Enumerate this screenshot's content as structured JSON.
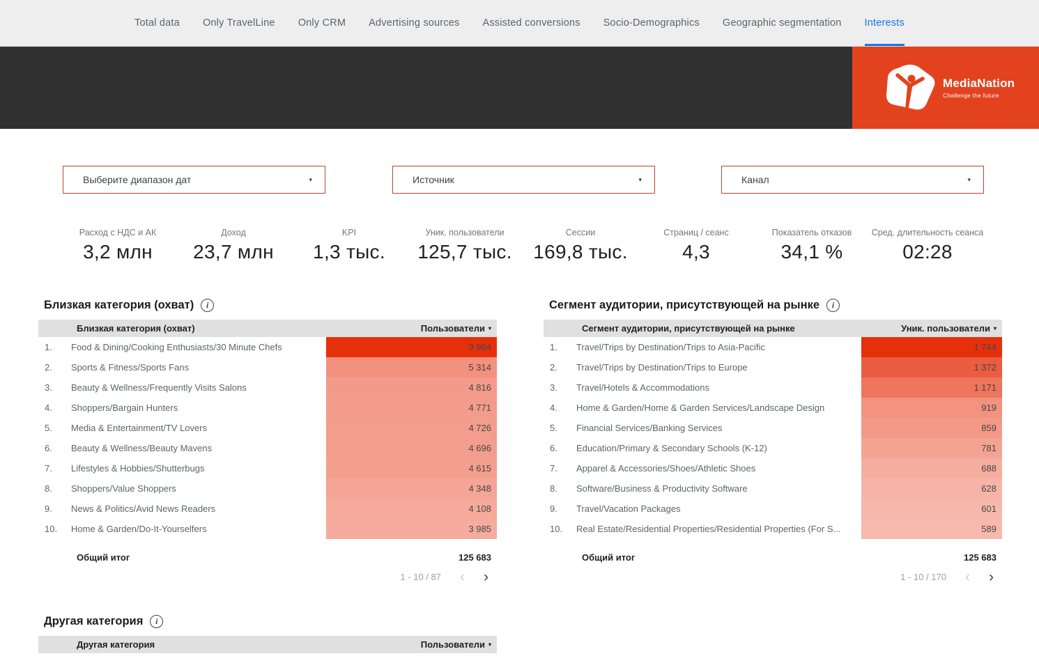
{
  "tabs": [
    {
      "label": "Total data",
      "active": false
    },
    {
      "label": "Only TravelLine",
      "active": false
    },
    {
      "label": "Only CRM",
      "active": false
    },
    {
      "label": "Advertising sources",
      "active": false
    },
    {
      "label": "Assisted conversions",
      "active": false
    },
    {
      "label": "Socio-Demographics",
      "active": false
    },
    {
      "label": "Geographic segmentation",
      "active": false
    },
    {
      "label": "Interests",
      "active": true
    }
  ],
  "brand": {
    "name": "MediaNation",
    "tagline": "Challenge the future"
  },
  "colors": {
    "accent_red": "#e2431e",
    "header_dark": "#313131",
    "heat_base": "#e6300c",
    "active_tab_blue": "#1a73e8",
    "filter_border": "#b04a2c"
  },
  "icons": {
    "sort_caret": "▾",
    "dropdown_caret": "▾",
    "info": "i",
    "page_prev": "‹",
    "page_next": "›"
  },
  "filters": [
    {
      "label": "Выберите диапазон дат"
    },
    {
      "label": "Источник"
    },
    {
      "label": "Канал"
    }
  ],
  "kpis": [
    {
      "label": "Расход с НДС и АК",
      "value": "3,2 млн"
    },
    {
      "label": "Доход",
      "value": "23,7 млн"
    },
    {
      "label": "KPI",
      "value": "1,3 тыс."
    },
    {
      "label": "Уник. пользователи",
      "value": "125,7 тыс."
    },
    {
      "label": "Сессии",
      "value": "169,8 тыс."
    },
    {
      "label": "Страниц / сеанс",
      "value": "4,3"
    },
    {
      "label": "Показатель отказов",
      "value": "34,1 %"
    },
    {
      "label": "Сред. длительность сеанса",
      "value": "02:28"
    }
  ],
  "tables": [
    {
      "title": "Близкая категория (охват)",
      "col_dimension": "Близкая категория (охват)",
      "col_metric": "Пользователи",
      "max": 9964,
      "rows": [
        {
          "n": "1.",
          "label": "Food & Dining/Cooking Enthusiasts/30 Minute Chefs",
          "display": "9 964",
          "value": 9964
        },
        {
          "n": "2.",
          "label": "Sports & Fitness/Sports Fans",
          "display": "5 314",
          "value": 5314
        },
        {
          "n": "3.",
          "label": "Beauty & Wellness/Frequently Visits Salons",
          "display": "4 816",
          "value": 4816
        },
        {
          "n": "4.",
          "label": "Shoppers/Bargain Hunters",
          "display": "4 771",
          "value": 4771
        },
        {
          "n": "5.",
          "label": "Media & Entertainment/TV Lovers",
          "display": "4 726",
          "value": 4726
        },
        {
          "n": "6.",
          "label": "Beauty & Wellness/Beauty Mavens",
          "display": "4 696",
          "value": 4696
        },
        {
          "n": "7.",
          "label": "Lifestyles & Hobbies/Shutterbugs",
          "display": "4 615",
          "value": 4615
        },
        {
          "n": "8.",
          "label": "Shoppers/Value Shoppers",
          "display": "4 348",
          "value": 4348
        },
        {
          "n": "9.",
          "label": "News & Politics/Avid News Readers",
          "display": "4 108",
          "value": 4108
        },
        {
          "n": "10.",
          "label": "Home & Garden/Do-It-Yourselfers",
          "display": "3 985",
          "value": 3985
        }
      ],
      "total_label": "Общий итог",
      "total_value": "125 683",
      "pagination": "1 - 10 / 87"
    },
    {
      "title": "Сегмент аудитории, присутствующей на рынке",
      "col_dimension": "Сегмент аудитории, присутствующей на рынке",
      "col_metric": "Уник. пользователи",
      "max": 1744,
      "rows": [
        {
          "n": "1.",
          "label": "Travel/Trips by Destination/Trips to Asia-Pacific",
          "display": "1 744",
          "value": 1744
        },
        {
          "n": "2.",
          "label": "Travel/Trips by Destination/Trips to Europe",
          "display": "1 372",
          "value": 1372
        },
        {
          "n": "3.",
          "label": "Travel/Hotels & Accommodations",
          "display": "1 171",
          "value": 1171
        },
        {
          "n": "4.",
          "label": "Home & Garden/Home & Garden Services/Landscape Design",
          "display": "919",
          "value": 919
        },
        {
          "n": "5.",
          "label": "Financial Services/Banking Services",
          "display": "859",
          "value": 859
        },
        {
          "n": "6.",
          "label": "Education/Primary & Secondary Schools (K-12)",
          "display": "781",
          "value": 781
        },
        {
          "n": "7.",
          "label": "Apparel & Accessories/Shoes/Athletic Shoes",
          "display": "688",
          "value": 688
        },
        {
          "n": "8.",
          "label": "Software/Business & Productivity Software",
          "display": "628",
          "value": 628
        },
        {
          "n": "9.",
          "label": "Travel/Vacation Packages",
          "display": "601",
          "value": 601
        },
        {
          "n": "10.",
          "label": "Real Estate/Residential Properties/Residential Properties (For S...",
          "display": "589",
          "value": 589
        }
      ],
      "total_label": "Общий итог",
      "total_value": "125 683",
      "pagination": "1 - 10 / 170"
    },
    {
      "title": "Другая категория",
      "col_dimension": "Другая категория",
      "col_metric": "Пользователи",
      "max": 0,
      "rows": [],
      "total_label": "",
      "total_value": "",
      "pagination": ""
    }
  ]
}
